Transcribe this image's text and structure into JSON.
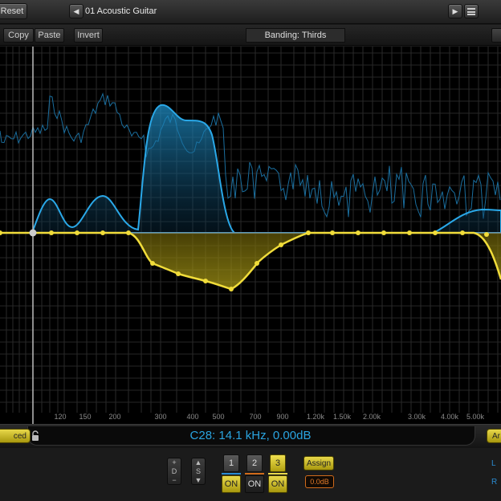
{
  "header": {
    "reset_label": "Reset",
    "prev_icon": "◀",
    "next_icon": "▶",
    "preset_name": "01 Acoustic Guitar"
  },
  "toolbar": {
    "copy_label": "Copy",
    "paste_label": "Paste",
    "invert_label": "Invert",
    "banding_label": "Banding: Thirds"
  },
  "graph": {
    "frequency_labels": [
      "120",
      "150",
      "200",
      "300",
      "400",
      "500",
      "700",
      "900",
      "1.20k",
      "1.50k",
      "2.00k",
      "3.00k",
      "4.00k",
      "5.00k"
    ],
    "colors": {
      "spectrum": "#1f8fc8",
      "eq_curve": "#f0dc3a",
      "grid": "#2a2a2a",
      "zero_line": "#777777"
    }
  },
  "status": {
    "readout": "C28: 14.1 kHz, 0.00dB",
    "advanced_label": "ced",
    "analysis_label": "Ar"
  },
  "bottom": {
    "stepper_d": {
      "plus": "+",
      "label": "D",
      "minus": "−"
    },
    "stepper_s": {
      "up": "▲",
      "label": "S",
      "down": "▼"
    },
    "bands": [
      {
        "num": "1",
        "on": "ON",
        "color": "#2a8ad0"
      },
      {
        "num": "2",
        "on": "ON",
        "color": "#d06a1a"
      },
      {
        "num": "3",
        "on": "ON",
        "color": "#e8d84a"
      }
    ],
    "assign_label": "Assign",
    "gain_value": "0.0dB",
    "left_label": "L",
    "right_label": "R"
  }
}
